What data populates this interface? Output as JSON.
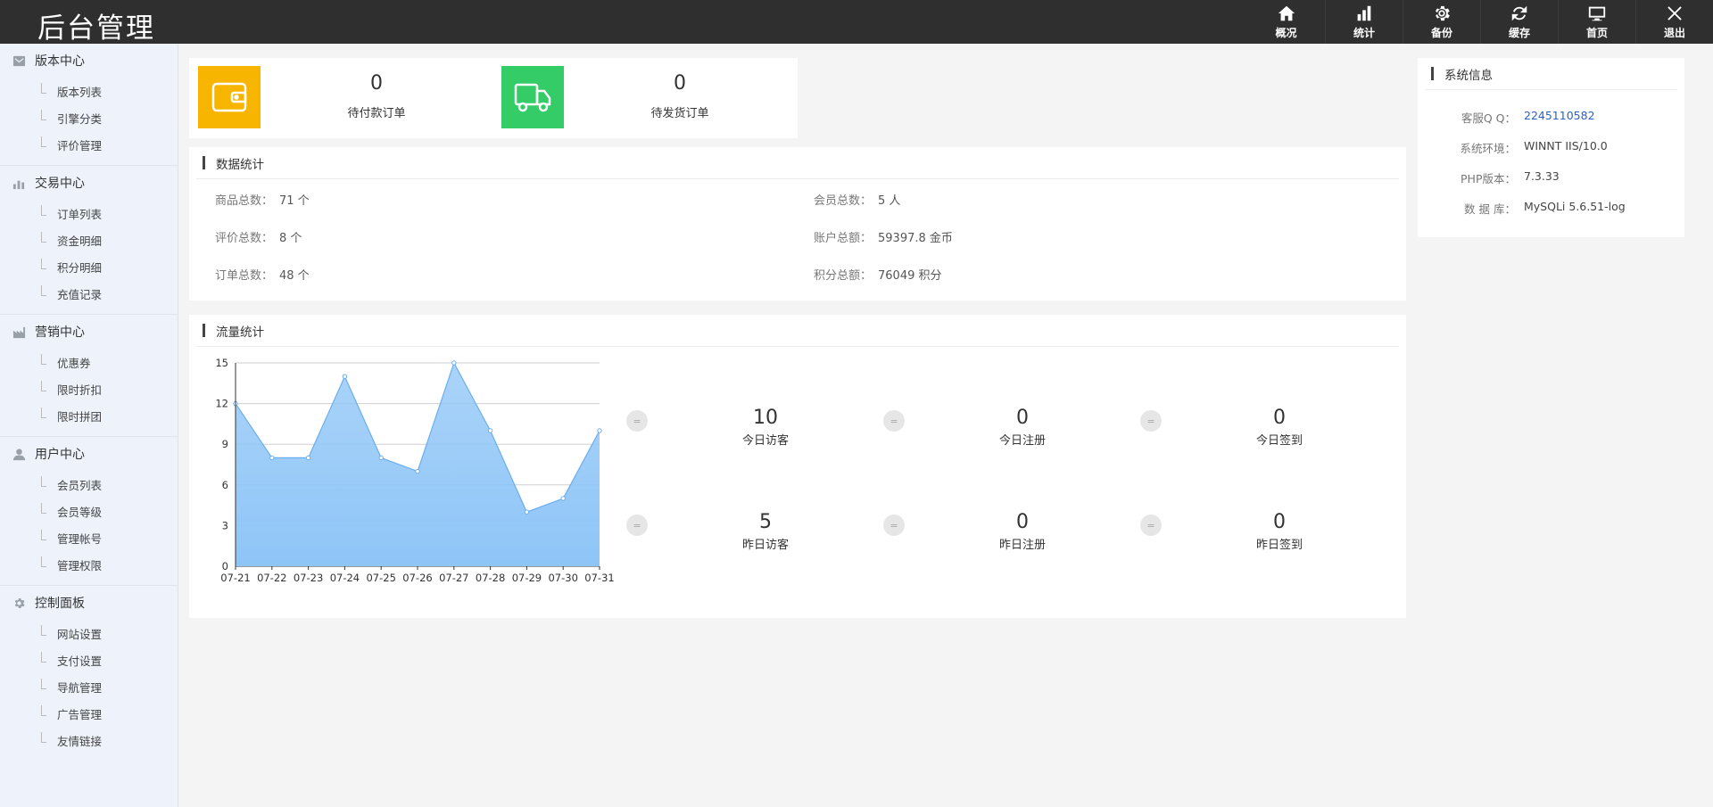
{
  "header": {
    "logo": "后台管理",
    "nav": [
      {
        "label": "概况",
        "icon": "home-icon"
      },
      {
        "label": "统计",
        "icon": "bar-chart-icon"
      },
      {
        "label": "备份",
        "icon": "gear-icon"
      },
      {
        "label": "缓存",
        "icon": "refresh-icon"
      },
      {
        "label": "首页",
        "icon": "monitor-icon"
      },
      {
        "label": "退出",
        "icon": "close-icon"
      }
    ]
  },
  "sidebar": {
    "groups": [
      {
        "title": "版本中心",
        "icon": "mail-icon",
        "items": [
          "版本列表",
          "引擎分类",
          "评价管理"
        ]
      },
      {
        "title": "交易中心",
        "icon": "bar-chart-icon",
        "items": [
          "订单列表",
          "资金明细",
          "积分明细",
          "充值记录"
        ]
      },
      {
        "title": "营销中心",
        "icon": "factory-icon",
        "items": [
          "优惠券",
          "限时折扣",
          "限时拼团"
        ]
      },
      {
        "title": "用户中心",
        "icon": "user-icon",
        "items": [
          "会员列表",
          "会员等级",
          "管理帐号",
          "管理权限"
        ]
      },
      {
        "title": "控制面板",
        "icon": "gear-icon",
        "items": [
          "网站设置",
          "支付设置",
          "导航管理",
          "广告管理",
          "友情链接"
        ]
      }
    ]
  },
  "orders": {
    "pending_payment": {
      "value": "0",
      "label": "待付款订单",
      "color": "#f7b500"
    },
    "pending_shipment": {
      "value": "0",
      "label": "待发货订单",
      "color": "#33cc66"
    }
  },
  "data_stats": {
    "title": "数据统计",
    "rows": [
      {
        "key": "商品总数：",
        "value": "71 个"
      },
      {
        "key": "会员总数：",
        "value": "5 人"
      },
      {
        "key": "评价总数：",
        "value": "8 个"
      },
      {
        "key": "账户总额：",
        "value": "59397.8 金币"
      },
      {
        "key": "订单总数：",
        "value": "48 个"
      },
      {
        "key": "积分总额：",
        "value": "76049 积分"
      }
    ]
  },
  "system_info": {
    "title": "系统信息",
    "rows": [
      {
        "key": "客服Q Q：",
        "value": "2245110582"
      },
      {
        "key": "系统环境：",
        "value": "WINNT IIS/10.0"
      },
      {
        "key": "PHP版本：",
        "value": "7.3.33"
      },
      {
        "key": "数 据 库：",
        "value": "MySQLi 5.6.51-log"
      }
    ]
  },
  "traffic": {
    "title": "流量统计",
    "eq_symbol": "=",
    "metrics": [
      {
        "value": "10",
        "label": "今日访客"
      },
      {
        "value": "0",
        "label": "今日注册"
      },
      {
        "value": "0",
        "label": "今日签到"
      },
      {
        "value": "5",
        "label": "昨日访客"
      },
      {
        "value": "0",
        "label": "昨日注册"
      },
      {
        "value": "0",
        "label": "昨日签到"
      }
    ]
  },
  "chart_data": {
    "type": "area",
    "x": [
      "07-21",
      "07-22",
      "07-23",
      "07-24",
      "07-25",
      "07-26",
      "07-27",
      "07-28",
      "07-29",
      "07-30",
      "07-31"
    ],
    "series": [
      {
        "values": [
          12,
          8,
          8,
          14,
          8,
          7,
          15,
          10,
          4,
          5,
          10
        ]
      }
    ],
    "y_ticks": [
      0,
      3,
      6,
      9,
      12,
      15
    ],
    "ylim": [
      0,
      15
    ],
    "grid": true,
    "fill_color": "#8ec5f7",
    "line_color": "#6aaef0"
  }
}
